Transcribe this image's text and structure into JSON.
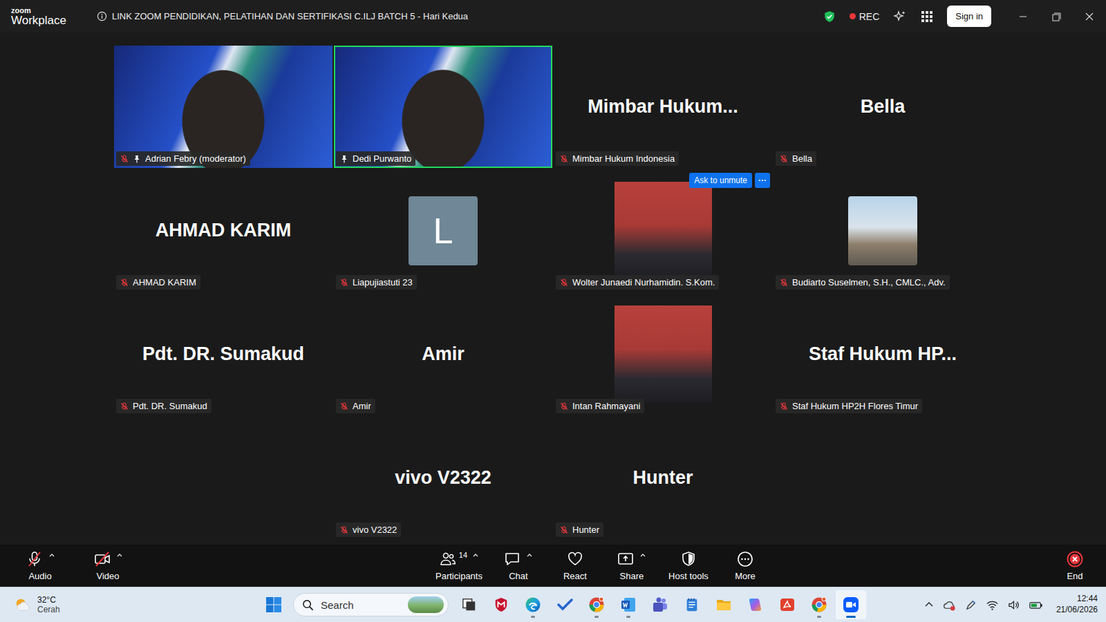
{
  "window": {
    "brand": "zoom",
    "product": "Workplace",
    "title": "LINK ZOOM PENDIDIKAN, PELATIHAN DAN SERTIFIKASI C.ILJ BATCH 5 - Hari Kedua",
    "encrypted": true,
    "recording": true,
    "rec_label": "REC",
    "sign_in": "Sign in"
  },
  "gallery": {
    "hover_actions": {
      "ask": "Ask to unmute",
      "more": "···"
    },
    "rows": [
      [
        {
          "kind": "video",
          "big": "",
          "label": "Adrian Febry (moderator)",
          "pinned": true,
          "muted": true,
          "speaking": false,
          "hovered": false
        },
        {
          "kind": "video",
          "big": "",
          "label": "Dedi Purwanto",
          "pinned": true,
          "muted": false,
          "speaking": true,
          "hovered": false
        },
        {
          "kind": "name",
          "big": "Mimbar Hukum...",
          "label": "Mimbar Hukum Indonesia",
          "pinned": false,
          "muted": true,
          "speaking": false,
          "hovered": false
        },
        {
          "kind": "name",
          "big": "Bella",
          "label": "Bella",
          "pinned": false,
          "muted": true,
          "speaking": false,
          "hovered": false
        }
      ],
      [
        {
          "kind": "name",
          "big": "AHMAD KARIM",
          "label": "AHMAD KARIM",
          "pinned": false,
          "muted": true,
          "speaking": false,
          "hovered": false
        },
        {
          "kind": "letter",
          "big": "L",
          "label": "Liapujiastuti 23",
          "pinned": false,
          "muted": true,
          "speaking": false,
          "hovered": false
        },
        {
          "kind": "photo",
          "big": "",
          "label": "Wolter Junaedi Nurhamidin. S.Kom.",
          "pinned": false,
          "muted": true,
          "speaking": false,
          "hovered": true
        },
        {
          "kind": "thumb",
          "big": "",
          "label": "Budiarto Suselmen, S.H., CMLC., Adv.",
          "pinned": false,
          "muted": true,
          "speaking": false,
          "hovered": false
        }
      ],
      [
        {
          "kind": "name",
          "big": "Pdt. DR. Sumakud",
          "label": "Pdt. DR. Sumakud",
          "pinned": false,
          "muted": true,
          "speaking": false,
          "hovered": false
        },
        {
          "kind": "name",
          "big": "Amir",
          "label": "Amir",
          "pinned": false,
          "muted": true,
          "speaking": false,
          "hovered": false
        },
        {
          "kind": "photo",
          "big": "",
          "label": "Intan Rahmayani",
          "pinned": false,
          "muted": true,
          "speaking": false,
          "hovered": false
        },
        {
          "kind": "name",
          "big": "Staf Hukum HP...",
          "label": "Staf Hukum HP2H Flores Timur",
          "pinned": false,
          "muted": true,
          "speaking": false,
          "hovered": false
        }
      ],
      [
        {
          "kind": "name",
          "big": "vivo V2322",
          "label": "vivo V2322",
          "pinned": false,
          "muted": true,
          "speaking": false,
          "hovered": false
        },
        {
          "kind": "name",
          "big": "Hunter",
          "label": "Hunter",
          "pinned": false,
          "muted": true,
          "speaking": false,
          "hovered": false
        }
      ]
    ]
  },
  "toolbar": {
    "left": [
      {
        "label": "Audio",
        "kind": "audio",
        "off": true,
        "caret": true
      },
      {
        "label": "Video",
        "kind": "video",
        "off": true,
        "caret": true
      }
    ],
    "center": [
      {
        "label": "Participants",
        "kind": "participants",
        "count": "14",
        "caret": true
      },
      {
        "label": "Chat",
        "kind": "chat",
        "caret": true
      },
      {
        "label": "React",
        "kind": "react",
        "caret": false
      },
      {
        "label": "Share",
        "kind": "share",
        "caret": true
      },
      {
        "label": "Host tools",
        "kind": "host",
        "caret": false
      },
      {
        "label": "More",
        "kind": "more",
        "caret": false
      }
    ],
    "end": {
      "label": "End"
    }
  },
  "taskbar": {
    "weather": {
      "temp": "32°C",
      "condition": "Cerah"
    },
    "search": {
      "placeholder": "Search"
    },
    "apps": [
      {
        "kind": "taskview",
        "open": false,
        "active": false
      },
      {
        "kind": "mcafee",
        "open": false,
        "active": false
      },
      {
        "kind": "edge",
        "open": true,
        "active": false
      },
      {
        "kind": "todo",
        "open": false,
        "active": false
      },
      {
        "kind": "chrome",
        "open": true,
        "active": false
      },
      {
        "kind": "word",
        "open": true,
        "active": false
      },
      {
        "kind": "teams",
        "open": false,
        "active": false
      },
      {
        "kind": "notepad",
        "open": false,
        "active": false
      },
      {
        "kind": "explorer",
        "open": false,
        "active": false
      },
      {
        "kind": "copilot",
        "open": false,
        "active": false
      },
      {
        "kind": "pdf",
        "open": false,
        "active": false
      },
      {
        "kind": "chrome",
        "open": true,
        "active": false
      },
      {
        "kind": "zoom",
        "open": true,
        "active": true
      }
    ],
    "clock": {
      "time": "12:44",
      "date": "21/06/2026"
    }
  }
}
